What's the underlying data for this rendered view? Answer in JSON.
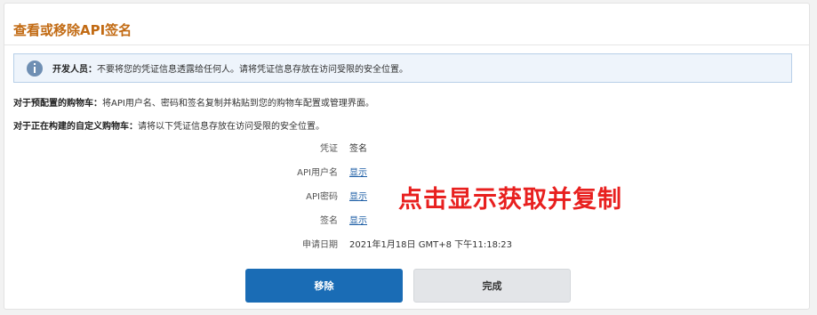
{
  "page": {
    "title": "查看或移除API签名"
  },
  "notice": {
    "label": "开发人员：",
    "text": "不要将您的凭证信息透露给任何人。请将凭证信息存放在访问受限的安全位置。"
  },
  "instructions": [
    {
      "label": "对于预配置的购物车：",
      "text": "将API用户名、密码和签名复制并粘贴到您的购物车配置或管理界面。"
    },
    {
      "label": "对于正在构建的自定义购物车：",
      "text": "请将以下凭证信息存放在访问受限的安全位置。"
    }
  ],
  "credentials": {
    "header_label": "凭证",
    "header_value": "签名",
    "username_label": "API用户名",
    "username_link": "显示",
    "password_label": "API密码",
    "password_link": "显示",
    "signature_label": "签名",
    "signature_link": "显示",
    "date_label": "申请日期",
    "date_value": "2021年1月18日 GMT+8 下午11:18:23"
  },
  "annotation": {
    "text": "点击显示获取并复制",
    "color": "#e8201f"
  },
  "buttons": {
    "remove_label": "移除",
    "done_label": "完成"
  },
  "colors": {
    "title": "#c26b14",
    "primary_button": "#1a6cb5",
    "link": "#1f5fa6"
  }
}
